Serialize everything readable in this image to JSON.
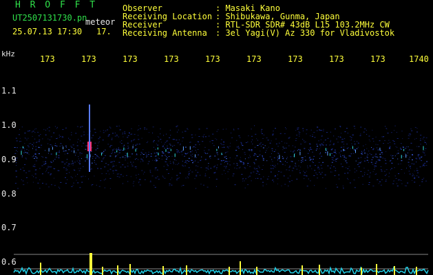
{
  "header": {
    "title": "H R O F F T",
    "file": "UT2507131730.pn",
    "meteor": "meteor",
    "date_time": "25.07.13 17:30",
    "count": "17.",
    "fields": [
      {
        "label": "Observer",
        "value": ": Masaki Kano"
      },
      {
        "label": "Receiving Location",
        "value": ": Shibukawa, Gunma, Japan"
      },
      {
        "label": "Receiver",
        "value": ": RTL-SDR SDR# 43dB L15 103.2MHz CW"
      },
      {
        "label": "Receiving Antenna",
        "value": ": 3el Yagi(V) Az 330 for Vladivostok"
      }
    ]
  },
  "axis": {
    "y_unit": "kHz",
    "x_ticks": [
      "173",
      "173",
      "173",
      "173",
      "173",
      "173",
      "173",
      "173",
      "173",
      "1740"
    ],
    "y_ticks": [
      "1.1",
      "1.0",
      "0.9",
      "0.8",
      "0.7",
      "0.6"
    ]
  },
  "colors": {
    "header_green": "#2fe04a",
    "tick_yellow": "#ffff3a",
    "text_white": "#e8e8e8",
    "spectrum_blue": "#1a2a8a",
    "echo_red": "#ff3070",
    "level_cyan": "#22d0e8",
    "background": "#000000"
  }
}
